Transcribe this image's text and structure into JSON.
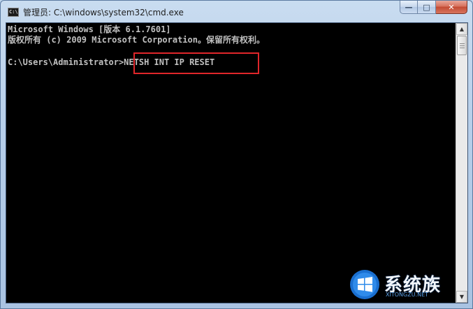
{
  "window": {
    "title": "管理员: C:\\windows\\system32\\cmd.exe",
    "icon_label": "C:\\",
    "icon": "cmd-icon"
  },
  "caption": {
    "minimize_glyph": "—",
    "maximize_glyph": "□",
    "close_glyph": "✕"
  },
  "console": {
    "lines": [
      "Microsoft Windows [版本 6.1.7601]",
      "版权所有 (c) 2009 Microsoft Corporation。保留所有权利。",
      "",
      "C:\\Users\\Administrator>NETSH INT IP RESET"
    ],
    "highlighted_command": "NETSH INT IP RESET",
    "highlight_color": "#e0262a"
  },
  "scrollbar": {
    "up_glyph": "▲",
    "down_glyph": "▼"
  },
  "watermark": {
    "text": "系统族",
    "subtext": "XITONGZU.NET",
    "logo": "windows-logo"
  },
  "colors": {
    "console_bg": "#000000",
    "console_fg": "#c0c0c0",
    "titlebar": "#b7cfea",
    "close_button": "#c24a33"
  }
}
